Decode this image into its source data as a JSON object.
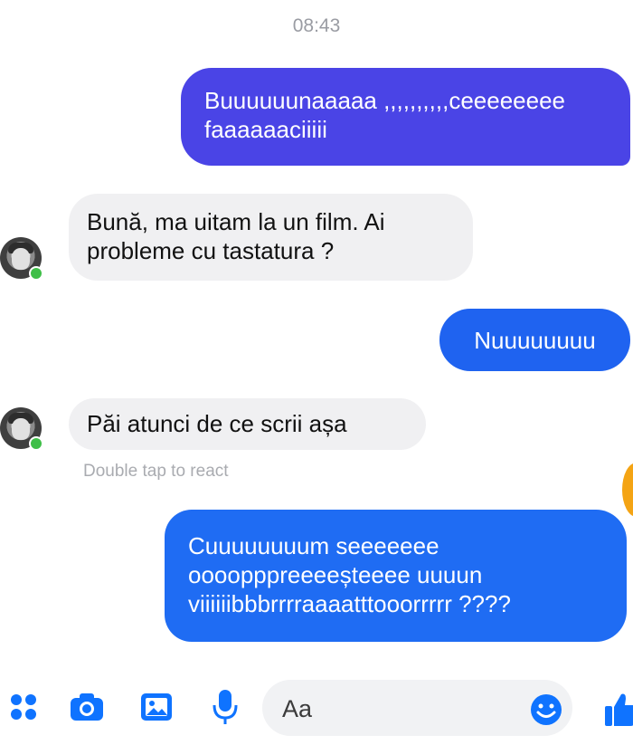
{
  "timestamp": "08:43",
  "messages": [
    {
      "direction": "outgoing",
      "lines": [
        "Buuuuuunaaaaa ,,,,,,,,,,ceeeeeeee",
        "faaaaaaciiiii"
      ]
    },
    {
      "direction": "incoming",
      "lines": [
        "Bună, ma uitam la un film. Ai",
        "probleme cu tastatura ?"
      ]
    },
    {
      "direction": "outgoing",
      "lines": [
        "Nuuuuuuuu"
      ]
    },
    {
      "direction": "incoming",
      "lines": [
        "Păi atunci de ce scrii așa"
      ]
    },
    {
      "direction": "outgoing",
      "lines": [
        "Cuuuuuuuum seeeeeee",
        "oooopppreeeeșteeee uuuun",
        "viiiiiibbbrrrraaaatttooorrrrr ????"
      ]
    }
  ],
  "react_hint": "Double tap to react",
  "composer": {
    "placeholder": "Aa"
  },
  "toolbar": {
    "icons": [
      "apps-icon",
      "camera-icon",
      "image-icon",
      "microphone-icon",
      "emoji-icon",
      "thumbs-up-icon"
    ]
  },
  "colors": {
    "outgoing_bubble_1": "#4a44e6",
    "outgoing_bubble_2": "#1f63f0",
    "outgoing_bubble_3": "#1f6cf3",
    "incoming_bubble": "#f0f0f2",
    "accent": "#0f73ff",
    "online": "#3fbf48"
  }
}
